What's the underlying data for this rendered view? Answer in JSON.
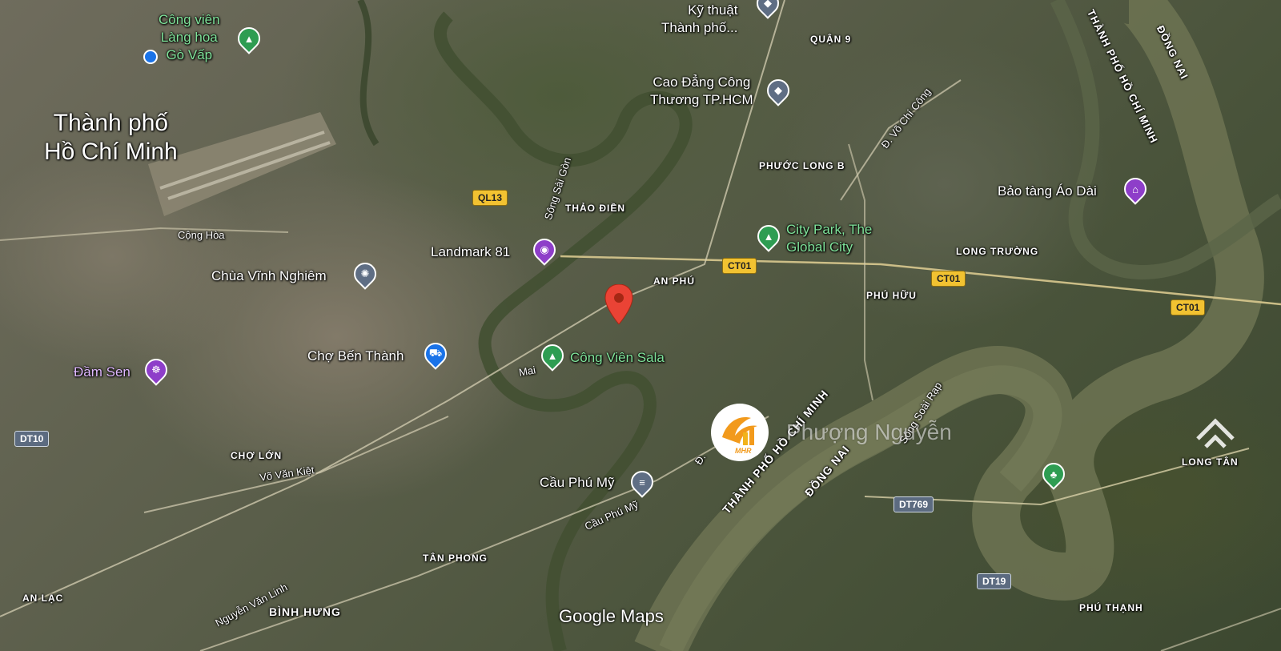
{
  "map": {
    "attribution": "Google Maps",
    "watermark": {
      "text": "Phượng Nguyễn",
      "logo_text": "MHR"
    },
    "corner_logo_label": "LONG TÂN",
    "city_label": {
      "line1": "Thành phố",
      "line2": "Hồ Chí Minh"
    },
    "pois": {
      "cong_vien_lang_hoa": {
        "line1": "Công viên",
        "line2": "Làng hoa",
        "line3": "Gò Vấp"
      },
      "ky_thuat": {
        "line1": "Kỹ thuật",
        "line2": "Thành phố..."
      },
      "cao_dang": {
        "line1": "Cao Đẳng Công",
        "line2": "Thương TP.HCM"
      },
      "city_park": {
        "line1": "City Park, The",
        "line2": "Global City"
      },
      "bao_tang": "Bảo tàng Áo Dài",
      "landmark81": "Landmark 81",
      "chua_vinh_nghiem": "Chùa Vĩnh Nghiêm",
      "cho_ben_thanh": "Chợ Bến Thành",
      "cong_vien_sala": "Công Viên Sala",
      "dam_sen": "Đầm Sen",
      "cau_phu_my": "Cầu Phú Mỹ"
    },
    "districts": {
      "quan9": "QUẬN 9",
      "phuoc_long_b": "PHƯỚC LONG B",
      "thao_dien": "THẢO ĐIỀN",
      "an_phu": "AN PHÚ",
      "phu_huu": "PHÚ HỮU",
      "long_truong": "LONG TRƯỜNG",
      "cho_lon": "CHỢ LỚN",
      "tan_phong": "TÂN PHONG",
      "an_lac": "AN LẠC",
      "binh_hung": "BÌNH HƯNG",
      "phu_thanh": "PHÚ THẠNH"
    },
    "roads": {
      "cong_hoa": "Cộng Hòa",
      "vo_van_kiet": "Võ Văn Kiệt",
      "mai": "Mai",
      "cau_phu_my_road": "Cầu Phú Mỹ",
      "nguyen_van_linh": "Nguyễn Văn Linh",
      "song_sai_gon": "Sông Sài Gòn",
      "vo_chi_cong": "Đ. Võ Chí Công",
      "song_soai_rap": "Sông Soài Rạp",
      "d_prefix": "Đ."
    },
    "boundaries": {
      "tphcm_vertical": "THÀNH PHỐ HỒ CHÍ MINH",
      "dong_nai_vertical": "ĐỒNG NAI",
      "tphcm_diag": "THÀNH PHỐ HỒ CHÍ MINH",
      "dong_nai_diag": "ĐỒNG NAI"
    },
    "shields": {
      "ql13": "QL13",
      "ct01_a": "CT01",
      "ct01_b": "CT01",
      "ct01_c": "CT01",
      "dt10": "DT10",
      "dt769": "DT769",
      "dt19": "DT19"
    },
    "colors": {
      "pin_red": "#ea4335",
      "poi_green": "#2e9d52",
      "poi_purple": "#8e3ec9",
      "poi_blue": "#1a73e8",
      "poi_grey": "#5f6e84",
      "water": "#4f5a3c",
      "river": "#6b7051"
    }
  }
}
